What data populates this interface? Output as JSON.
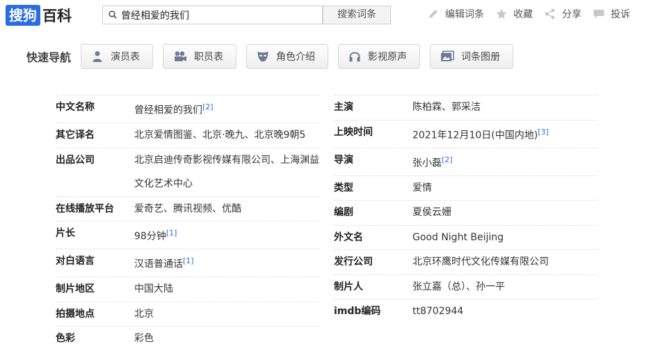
{
  "logo": {
    "mark": "搜狗",
    "text": "百科"
  },
  "search": {
    "value": "曾经相爱的我们",
    "button": "搜索词条"
  },
  "actions": [
    {
      "label": "编辑词条",
      "icon": "pencil-icon"
    },
    {
      "label": "收藏",
      "icon": "star-icon"
    },
    {
      "label": "分享",
      "icon": "share-icon"
    },
    {
      "label": "投诉",
      "icon": "comment-icon"
    }
  ],
  "nav": {
    "title": "快速导航",
    "items": [
      {
        "label": "演员表",
        "icon": "person-icon"
      },
      {
        "label": "职员表",
        "icon": "camera-icon"
      },
      {
        "label": "角色介绍",
        "icon": "mask-icon"
      },
      {
        "label": "影视原声",
        "icon": "headphones-icon"
      },
      {
        "label": "词条图册",
        "icon": "gallery-icon"
      }
    ]
  },
  "info_left": [
    {
      "key": "中文名称",
      "value": "曾经相爱的我们",
      "ref": "[2]"
    },
    {
      "key": "其它译名",
      "value": "北京爱情图鉴、北京·晚九、北京晚9朝5",
      "ref": ""
    },
    {
      "key": "出品公司",
      "value": "北京启迪传奇影视传媒有限公司、上海渊益文化艺术中心",
      "ref": ""
    },
    {
      "key": "在线播放平台",
      "value": "爱奇艺、腾讯视频、优酷",
      "ref": ""
    },
    {
      "key": "片长",
      "value": "98分钟",
      "ref": "[1]"
    },
    {
      "key": "对白语言",
      "value": "汉语普通话",
      "ref": "[1]"
    },
    {
      "key": "制片地区",
      "value": "中国大陆",
      "ref": ""
    },
    {
      "key": "拍摄地点",
      "value": "北京",
      "ref": ""
    },
    {
      "key": "色彩",
      "value": "彩色",
      "ref": ""
    }
  ],
  "info_right": [
    {
      "key": "主演",
      "value": "陈柏霖、郭采洁",
      "ref": ""
    },
    {
      "key": "上映时间",
      "value": "2021年12月10日(中国内地)",
      "ref": "[3]"
    },
    {
      "key": "导演",
      "value": "张小磊",
      "ref": "[2]"
    },
    {
      "key": "类型",
      "value": "爱情",
      "ref": ""
    },
    {
      "key": "编剧",
      "value": "夏侯云姗",
      "ref": ""
    },
    {
      "key": "外文名",
      "value": "Good Night Beijing",
      "ref": ""
    },
    {
      "key": "发行公司",
      "value": "北京环鹰时代文化传媒有限公司",
      "ref": ""
    },
    {
      "key": "制片人",
      "value": "张立嘉（总）、孙一平",
      "ref": ""
    },
    {
      "key": "imdb编码",
      "value": "tt8702944",
      "ref": ""
    }
  ]
}
